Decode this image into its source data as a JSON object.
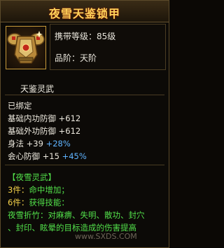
{
  "item": {
    "name": "夜雪天鉴锁甲",
    "carry_level_label": "携带等级：",
    "carry_level_value": "85级",
    "grade_label": "品阶：",
    "grade_value": "天阶",
    "icon": "armor-icon"
  },
  "section_name": "天鉴灵武",
  "bound_status": "已绑定",
  "stats": [
    {
      "label": "基础内功防御",
      "value": "+612"
    },
    {
      "label": "基础外功防御",
      "value": "+612"
    },
    {
      "label": "身法",
      "value": "+39",
      "bonus": "+28%"
    },
    {
      "label": "会心防御",
      "value": "+15",
      "bonus": "+45%"
    }
  ],
  "set": {
    "title": "【夜雪灵武】",
    "lines": [
      {
        "prefix": "3件：",
        "text": "命中增加；"
      },
      {
        "prefix": "6件：",
        "text": "获得技能："
      },
      {
        "prefix": "",
        "text": "夜雪折竹：对麻痹、失明、散功、封穴"
      },
      {
        "prefix": "",
        "text": "、封印、眩晕的目标造成的伤害提高"
      }
    ]
  },
  "watermark": "www.SXDS.COM",
  "colors": {
    "title": "#ffd35a",
    "bonus": "#5fb4ff",
    "set_title": "#52e04a",
    "set_prefix": "#f3d14a",
    "border": "#5b4a2a"
  }
}
